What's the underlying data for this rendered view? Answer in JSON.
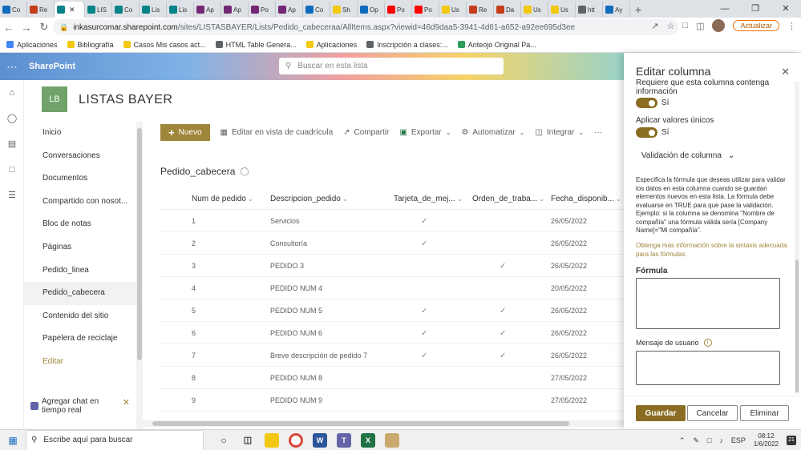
{
  "browser": {
    "tabs": [
      {
        "label": "Co",
        "color": "#0f6cbd",
        "icon": "outlook-icon"
      },
      {
        "label": "Re",
        "color": "#c43e1c",
        "icon": "office-icon"
      },
      {
        "label": "",
        "color": "#038387",
        "icon": "sharepoint-icon",
        "active": true
      },
      {
        "label": "LIS",
        "color": "#038387",
        "icon": "sharepoint-icon"
      },
      {
        "label": "Co",
        "color": "#038387",
        "icon": "sharepoint-icon"
      },
      {
        "label": "Lis",
        "color": "#038387",
        "icon": "sharepoint-icon"
      },
      {
        "label": "Lis",
        "color": "#038387",
        "icon": "sharepoint-icon"
      },
      {
        "label": "Ap",
        "color": "#742774",
        "icon": "powerapps-icon"
      },
      {
        "label": "Ap",
        "color": "#742774",
        "icon": "powerapps-icon"
      },
      {
        "label": "Po",
        "color": "#742774",
        "icon": "powerapps-icon"
      },
      {
        "label": "Ap",
        "color": "#742774",
        "icon": "powerapps-icon"
      },
      {
        "label": "Co",
        "color": "#0f6cbd",
        "icon": "outlook-icon"
      },
      {
        "label": "Sh",
        "color": "#f2c811",
        "icon": "folder-icon"
      },
      {
        "label": "Op",
        "color": "#0f6cbd",
        "icon": "outlook-icon"
      },
      {
        "label": "Po",
        "color": "#ff0000",
        "icon": "youtube-icon"
      },
      {
        "label": "Po",
        "color": "#ff0000",
        "icon": "youtube-icon"
      },
      {
        "label": "Us",
        "color": "#f2c811",
        "icon": "ms-icon"
      },
      {
        "label": "Re",
        "color": "#c43e1c",
        "icon": "office-icon"
      },
      {
        "label": "Da",
        "color": "#c43e1c",
        "icon": "office-icon"
      },
      {
        "label": "Us",
        "color": "#f2c811",
        "icon": "ms-icon"
      },
      {
        "label": "Us",
        "color": "#f2c811",
        "icon": "ms-icon"
      },
      {
        "label": "htt",
        "color": "#5f6368",
        "icon": "globe-icon"
      },
      {
        "label": "Ay",
        "color": "#0f6cbd",
        "icon": "help-icon"
      }
    ],
    "url_host": "inkasurcomar.sharepoint.com",
    "url_path": "/sites/LISTASBAYER/Lists/Pedido_cabeceraa/AllItems.aspx?viewid=46d9daa5-3941-4d61-a652-a92ee695d3ee",
    "update_label": "Actualizar",
    "bookmarks": [
      {
        "label": "Aplicaciones",
        "color": "#4285f4"
      },
      {
        "label": "Bibliografía",
        "color": "#f2c811"
      },
      {
        "label": "Casos Mis casos act...",
        "color": "#f2c811"
      },
      {
        "label": "HTML Table Genera...",
        "color": "#5f6368"
      },
      {
        "label": "Aplicaciones",
        "color": "#f2c811"
      },
      {
        "label": "Inscripción a clases:...",
        "color": "#5f6368"
      },
      {
        "label": "Anteojo Original Pa...",
        "color": "#2e9e5b"
      }
    ]
  },
  "suite": {
    "brand": "SharePoint",
    "search_placeholder": "Buscar en esta lista"
  },
  "site": {
    "logo": "LB",
    "title": "LISTAS BAYER"
  },
  "nav": {
    "items": [
      {
        "label": "Inicio"
      },
      {
        "label": "Conversaciones"
      },
      {
        "label": "Documentos"
      },
      {
        "label": "Compartido con nosot..."
      },
      {
        "label": "Bloc de notas"
      },
      {
        "label": "Páginas"
      },
      {
        "label": "Pedido_linea"
      },
      {
        "label": "Pedido_cabecera",
        "selected": true
      },
      {
        "label": "Contenido del sitio"
      },
      {
        "label": "Papelera de reciclaje"
      },
      {
        "label": "Editar",
        "edit": true
      }
    ],
    "chat_text": "Agregar chat en tiempo real"
  },
  "commands": {
    "new_label": "Nuevo",
    "grid_label": "Editar en vista de cuadrícula",
    "share_label": "Compartir",
    "export_label": "Exportar",
    "automate_label": "Automatizar",
    "integrate_label": "Integrar",
    "more_label": "···"
  },
  "list": {
    "title": "Pedido_cabecera",
    "columns": [
      "Num de pedido",
      "Descripcion_pedido",
      "Tarjeta_de_mej...",
      "Orden_de_traba...",
      "Fecha_disponib..."
    ],
    "rows": [
      {
        "num": "1",
        "desc": "Servicios",
        "tarjeta": true,
        "orden": false,
        "fecha": "26/05/2022"
      },
      {
        "num": "2",
        "desc": "Consultoría",
        "tarjeta": true,
        "orden": false,
        "fecha": "26/05/2022"
      },
      {
        "num": "3",
        "desc": "PEDIDO 3",
        "tarjeta": false,
        "orden": true,
        "fecha": "26/05/2022"
      },
      {
        "num": "4",
        "desc": "PEDIDO NUM 4",
        "tarjeta": false,
        "orden": false,
        "fecha": "20/05/2022"
      },
      {
        "num": "5",
        "desc": "PEDIDO NUM 5",
        "tarjeta": true,
        "orden": true,
        "fecha": "26/05/2022"
      },
      {
        "num": "6",
        "desc": "PEDIDO NUM 6",
        "tarjeta": true,
        "orden": true,
        "fecha": "26/05/2022"
      },
      {
        "num": "7",
        "desc": "Breve descripción de pedido 7",
        "tarjeta": true,
        "orden": true,
        "fecha": "26/05/2022"
      },
      {
        "num": "8",
        "desc": "PEDIDO NUM 8",
        "tarjeta": false,
        "orden": false,
        "fecha": "27/05/2022"
      },
      {
        "num": "9",
        "desc": "PEDIDO NUM 9",
        "tarjeta": false,
        "orden": false,
        "fecha": "27/05/2022"
      }
    ]
  },
  "panel": {
    "title": "Editar columna",
    "required_label": "Requiere que esta columna contenga información",
    "required_value": "Sí",
    "unique_label": "Aplicar valores únicos",
    "unique_value": "Sí",
    "validation_label": "Validación de columna",
    "description": "Especifica la fórmula que deseas utilizar para validar los datos en esta columna cuando se guardan elementos nuevos en esta lista. La fórmula debe evaluarse en TRUE para que pase la validación. Ejemplo: si la columna se denomina \"Nombre de compañía\" una fórmula válida sería [Company Name]=\"Mi compañía\".",
    "learn_more": "Obtenga más información sobre la sintaxis adecuada para las fórmulas.",
    "formula_label": "Fórmula",
    "formula_value": "",
    "message_label": "Mensaje de usuario",
    "message_value": "",
    "save_label": "Guardar",
    "cancel_label": "Cancelar",
    "delete_label": "Eliminar"
  },
  "taskbar": {
    "search_placeholder": "Escribe aquí para buscar",
    "language": "ESP",
    "time": "08:12",
    "date": "1/6/2022",
    "notifications": "21"
  },
  "colors": {
    "accent": "#a0863a",
    "toggle_on": "#8a6d22",
    "site_logo": "#6fa36a"
  }
}
